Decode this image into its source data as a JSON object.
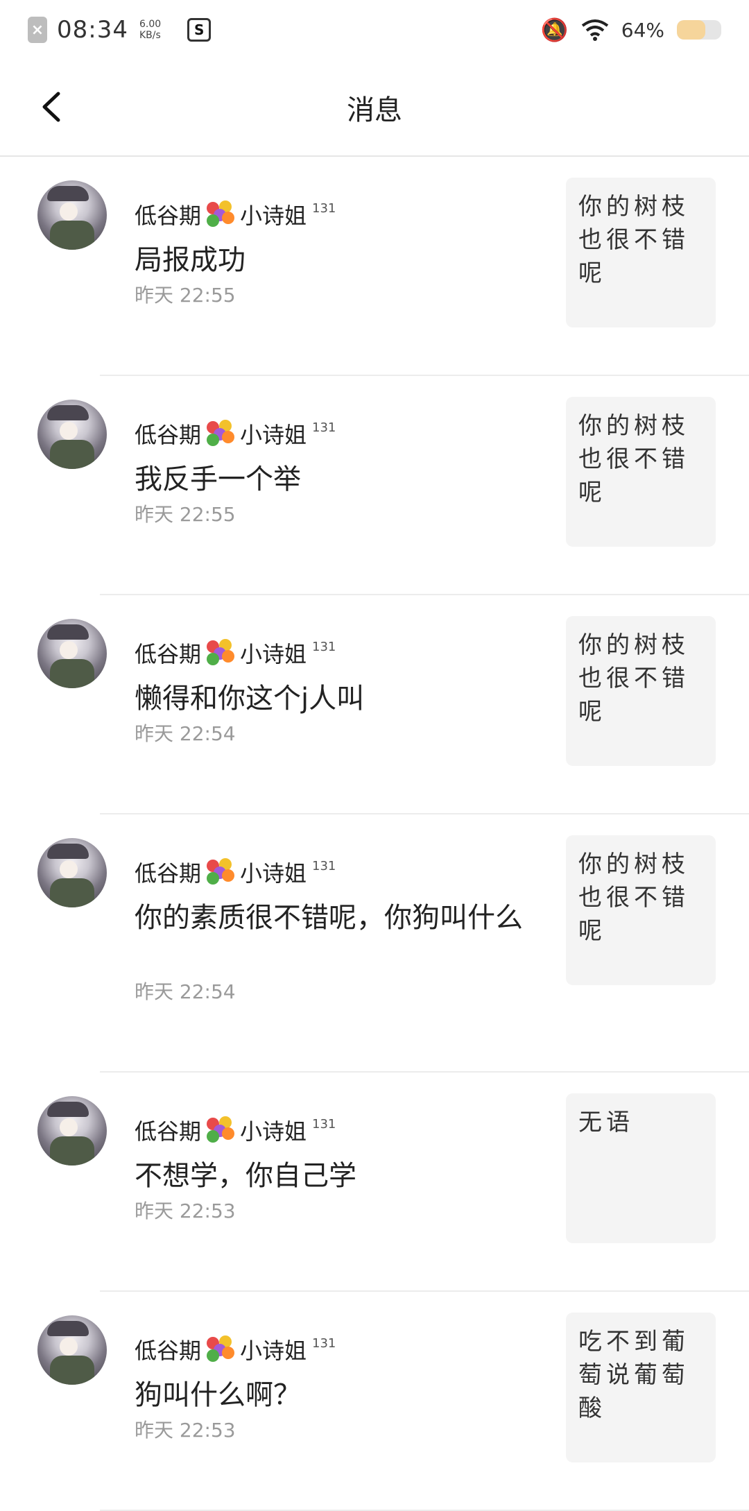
{
  "status_bar": {
    "app_badge": "×",
    "time": "08:34",
    "net_speed_value": "6.00",
    "net_speed_unit": "KB/s",
    "screenshot_icon": "S",
    "battery_percent": "64%",
    "battery_level": 0.64
  },
  "header": {
    "back": "back-arrow-icon",
    "title": "消息"
  },
  "messages": [
    {
      "sender": "低谷期",
      "sender_suffix": "小诗姐",
      "level": "131",
      "text": "局报成功",
      "time": "昨天 22:55",
      "quote": "你的树枝也很不错呢"
    },
    {
      "sender": "低谷期",
      "sender_suffix": "小诗姐",
      "level": "131",
      "text": "我反手一个举",
      "time": "昨天 22:55",
      "quote": "你的树枝也很不错呢"
    },
    {
      "sender": "低谷期",
      "sender_suffix": "小诗姐",
      "level": "131",
      "text": "懒得和你这个j人叫",
      "time": "昨天 22:54",
      "quote": "你的树枝也很不错呢"
    },
    {
      "sender": "低谷期",
      "sender_suffix": "小诗姐",
      "level": "131",
      "text": "你的素质很不错呢，你狗叫什么",
      "time": "昨天 22:54",
      "quote": "你的树枝也很不错呢"
    },
    {
      "sender": "低谷期",
      "sender_suffix": "小诗姐",
      "level": "131",
      "text": "不想学，你自己学",
      "time": "昨天 22:53",
      "quote": "无语"
    },
    {
      "sender": "低谷期",
      "sender_suffix": "小诗姐",
      "level": "131",
      "text": "狗叫什么啊？",
      "time": "昨天 22:53",
      "quote": "吃不到葡萄说葡萄酸"
    }
  ]
}
